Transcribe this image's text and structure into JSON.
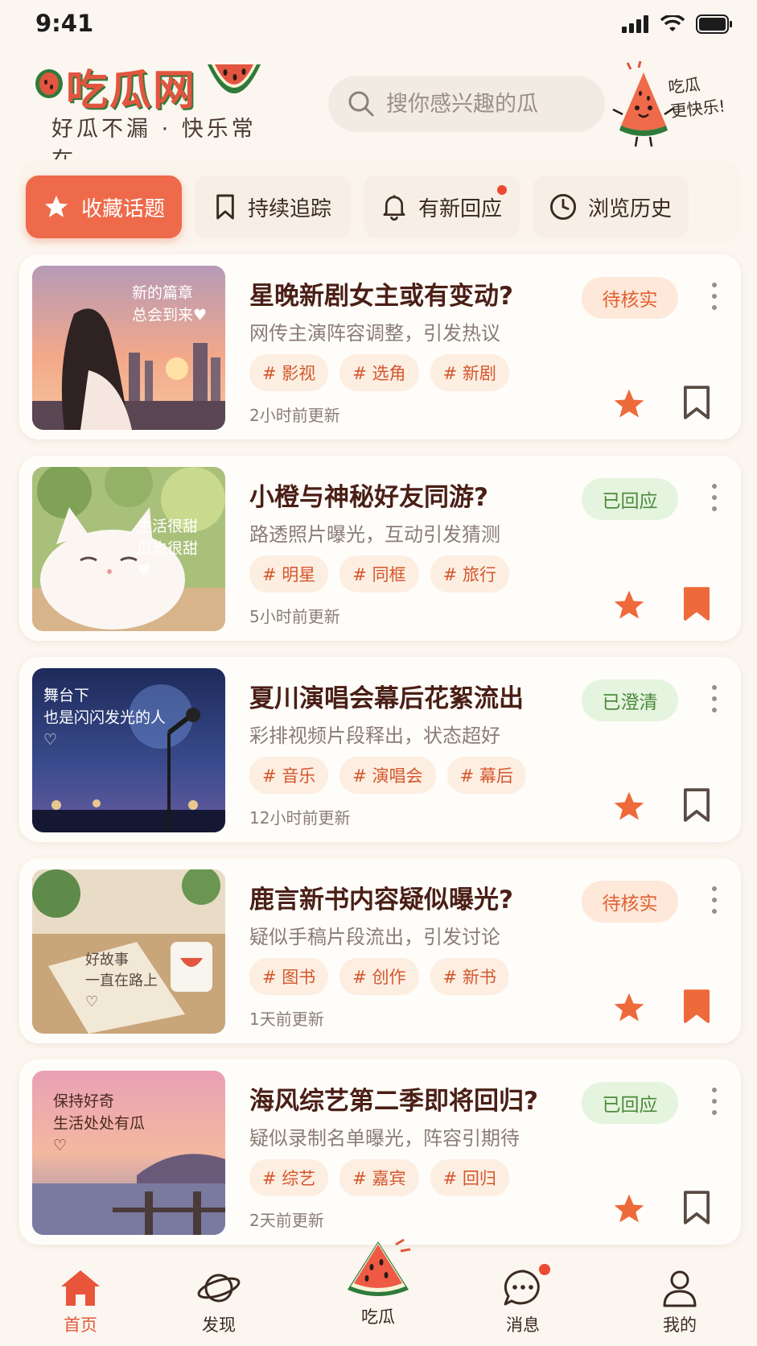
{
  "status_bar": {
    "time": "9:41"
  },
  "header": {
    "logo_title": "吃瓜网",
    "logo_slogan": "好瓜不漏 · 快乐常在",
    "search_placeholder": "搜你感兴趣的瓜",
    "mascot_text": "吃瓜\n更快乐!"
  },
  "tabs": [
    {
      "label": "收藏话题",
      "icon": "star-icon",
      "active": true
    },
    {
      "label": "持续追踪",
      "icon": "bookmark-icon",
      "active": false
    },
    {
      "label": "有新回应",
      "icon": "bell-icon",
      "active": false,
      "dot": true
    },
    {
      "label": "浏览历史",
      "icon": "clock-icon",
      "active": false
    }
  ],
  "cards": [
    {
      "title": "星晚新剧女主或有变动?",
      "subtitle": "网传主演阵容调整，引发热议",
      "tags": [
        "# 影视",
        "# 选角",
        "# 新剧"
      ],
      "time": "2小时前更新",
      "badge": "待核实",
      "badge_type": "pending",
      "bookmarked": false,
      "thumb_text": "新的篇章\n总会到来♥"
    },
    {
      "title": "小橙与神秘好友同游?",
      "subtitle": "路透照片曝光，互动引发猜测",
      "tags": [
        "# 明星",
        "# 同框",
        "# 旅行"
      ],
      "time": "5小时前更新",
      "badge": "已回应",
      "badge_type": "ok",
      "bookmarked": true,
      "thumb_text": "生活很甜\n瓜也很甜\n♥"
    },
    {
      "title": "夏川演唱会幕后花絮流出",
      "subtitle": "彩排视频片段释出，状态超好",
      "tags": [
        "# 音乐",
        "# 演唱会",
        "# 幕后"
      ],
      "time": "12小时前更新",
      "badge": "已澄清",
      "badge_type": "ok",
      "bookmarked": false,
      "thumb_text": "舞台下\n也是闪闪发光的人\n♡"
    },
    {
      "title": "鹿言新书内容疑似曝光?",
      "subtitle": "疑似手稿片段流出，引发讨论",
      "tags": [
        "# 图书",
        "# 创作",
        "# 新书"
      ],
      "time": "1天前更新",
      "badge": "待核实",
      "badge_type": "pending",
      "bookmarked": true,
      "thumb_text": "好故事\n一直在路上\n♡"
    },
    {
      "title": "海风综艺第二季即将回归?",
      "subtitle": "疑似录制名单曝光，阵容引期待",
      "tags": [
        "# 综艺",
        "# 嘉宾",
        "# 回归"
      ],
      "time": "2天前更新",
      "badge": "已回应",
      "badge_type": "ok",
      "bookmarked": false,
      "thumb_text": "保持好奇\n生活处处有瓜\n♡"
    }
  ],
  "bottom_nav": [
    {
      "label": "首页",
      "icon": "home-icon",
      "active": true
    },
    {
      "label": "发现",
      "icon": "planet-icon",
      "active": false
    },
    {
      "label": "吃瓜",
      "icon": "watermelon-icon",
      "active": false
    },
    {
      "label": "消息",
      "icon": "chat-icon",
      "active": false,
      "dot": true
    },
    {
      "label": "我的",
      "icon": "user-icon",
      "active": false
    }
  ],
  "colors": {
    "accent": "#ee6a4a",
    "background": "#fbf6ef",
    "badge_pending": "#e06030",
    "badge_ok": "#4c8a3c"
  }
}
